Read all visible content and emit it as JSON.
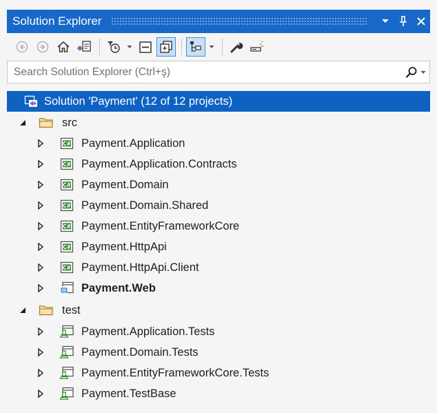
{
  "window": {
    "title": "Solution Explorer",
    "title_buttons": [
      "dropdown-icon",
      "pin-icon",
      "close-icon"
    ]
  },
  "toolbar": {
    "buttons": [
      {
        "name": "back-button",
        "icon": "back-circle-icon"
      },
      {
        "name": "forward-button",
        "icon": "forward-circle-icon"
      },
      {
        "name": "home-button",
        "icon": "home-icon"
      },
      {
        "name": "switch-views-button",
        "icon": "switch-views-icon"
      },
      {
        "name": "pending-changes-filter-button",
        "icon": "clock-filter-icon"
      },
      {
        "name": "collapse-all-button",
        "icon": "collapse-all-icon"
      },
      {
        "name": "show-all-files-button",
        "icon": "show-all-files-icon",
        "active": true
      },
      {
        "name": "sync-with-active-document-button",
        "icon": "sync-tree-icon"
      },
      {
        "name": "properties-button",
        "icon": "wrench-icon"
      },
      {
        "name": "preview-selected-items-button",
        "icon": "preview-icon"
      }
    ]
  },
  "search": {
    "placeholder": "Search Solution Explorer (Ctrl+ş)"
  },
  "tree": {
    "solution": {
      "label": "Solution 'Payment' (12 of 12 projects)",
      "icon": "solution-icon"
    },
    "folders": [
      {
        "label": "src",
        "icon": "folder-icon",
        "expanded": true,
        "items": [
          {
            "label": "Payment.Application",
            "icon": "csharp-project-icon"
          },
          {
            "label": "Payment.Application.Contracts",
            "icon": "csharp-project-icon"
          },
          {
            "label": "Payment.Domain",
            "icon": "csharp-project-icon"
          },
          {
            "label": "Payment.Domain.Shared",
            "icon": "csharp-project-icon"
          },
          {
            "label": "Payment.EntityFrameworkCore",
            "icon": "csharp-project-icon"
          },
          {
            "label": "Payment.HttpApi",
            "icon": "csharp-project-icon"
          },
          {
            "label": "Payment.HttpApi.Client",
            "icon": "csharp-project-icon"
          },
          {
            "label": "Payment.Web",
            "icon": "web-project-icon",
            "bold": true
          }
        ]
      },
      {
        "label": "test",
        "icon": "folder-icon",
        "expanded": true,
        "items": [
          {
            "label": "Payment.Application.Tests",
            "icon": "test-project-icon"
          },
          {
            "label": "Payment.Domain.Tests",
            "icon": "test-project-icon"
          },
          {
            "label": "Payment.EntityFrameworkCore.Tests",
            "icon": "test-project-icon"
          },
          {
            "label": "Payment.TestBase",
            "icon": "test-project-icon"
          }
        ]
      }
    ]
  },
  "colors": {
    "titlebar": "#1768c8",
    "selection": "#0e63c2",
    "background": "#f5f5f5",
    "csharp_green": "#388a34",
    "folder_gold": "#c08b2c"
  }
}
